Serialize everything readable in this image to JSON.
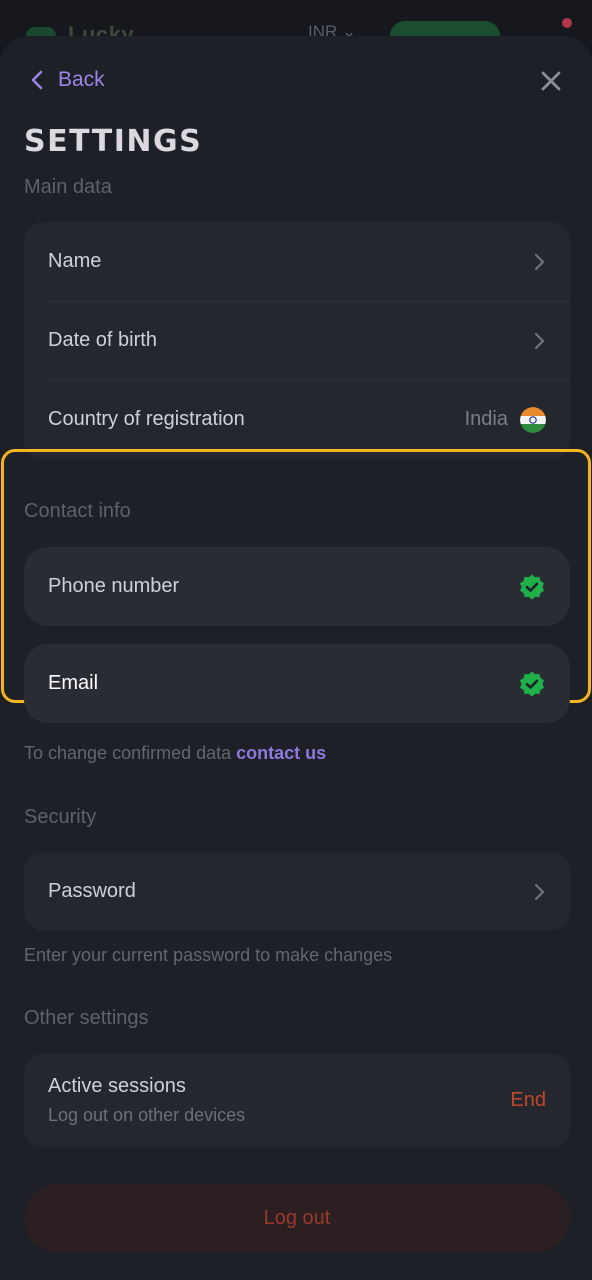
{
  "background": {
    "logo_text": "Lucky",
    "currency": "INR"
  },
  "header": {
    "back_label": "Back",
    "title": "SETTINGS"
  },
  "main_data": {
    "section_label": "Main data",
    "rows": [
      {
        "label": "Name"
      },
      {
        "label": "Date of birth"
      },
      {
        "label": "Country of registration",
        "value": "India"
      }
    ]
  },
  "contact_info": {
    "section_label": "Contact info",
    "rows": [
      {
        "label": "Phone number",
        "verified": true
      },
      {
        "label": "Email",
        "verified": true
      }
    ],
    "hint_text": "To change confirmed data",
    "hint_link": "contact us"
  },
  "security": {
    "section_label": "Security",
    "password_label": "Password",
    "hint_text": "Enter your current password to make changes"
  },
  "other_settings": {
    "section_label": "Other settings",
    "sessions_title": "Active sessions",
    "sessions_subtitle": "Log out on other devices",
    "end_label": "End"
  },
  "logout_label": "Log out",
  "colors": {
    "accent": "#9d85e6",
    "highlight": "#f4b421",
    "verified": "#1fb04a",
    "danger": "#c2472a"
  }
}
